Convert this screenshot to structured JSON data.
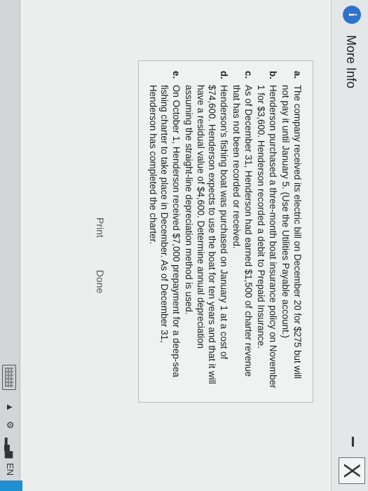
{
  "dialog": {
    "title": "More Info",
    "info_icon": "i",
    "close_label": "X",
    "minimize_label": "−"
  },
  "items": [
    {
      "letter": "a.",
      "text": "The company received its electric bill on December 20 for $275 but will not pay it until January 5. (Use the Utilities Payable account.)"
    },
    {
      "letter": "b.",
      "text": "Henderson purchased a three-month boat insurance policy on November 1 for $3,600. Henderson recorded a debit to Prepaid Insurance."
    },
    {
      "letter": "c.",
      "text": "As of December 31, Henderson had earned $1,500 of charter revenue that has not been recorded or received."
    },
    {
      "letter": "d.",
      "text": "Henderson's fishing boat was purchased on January 1 at a cost of $74,600. Henderson expects to use the boat for ten years and that it will have a residual value of $4,600. Determine annual depreciation assuming the straight-line depreciation method is used."
    },
    {
      "letter": "e.",
      "text": "On October 1, Henderson received $7,000 prepayment for a deep-sea fishing charter to take place in December. As of December 31, Henderson has completed the charter."
    }
  ],
  "buttons": {
    "print": "Print",
    "done": "Done"
  },
  "taskbar": {
    "language": "EN",
    "icons": [
      "keyboard-icon",
      "tray-arrow-icon",
      "network-icon",
      "signal-icon"
    ]
  },
  "colors": {
    "accent": "#2f73c9",
    "taskbar_accent": "#1e8fd0"
  }
}
